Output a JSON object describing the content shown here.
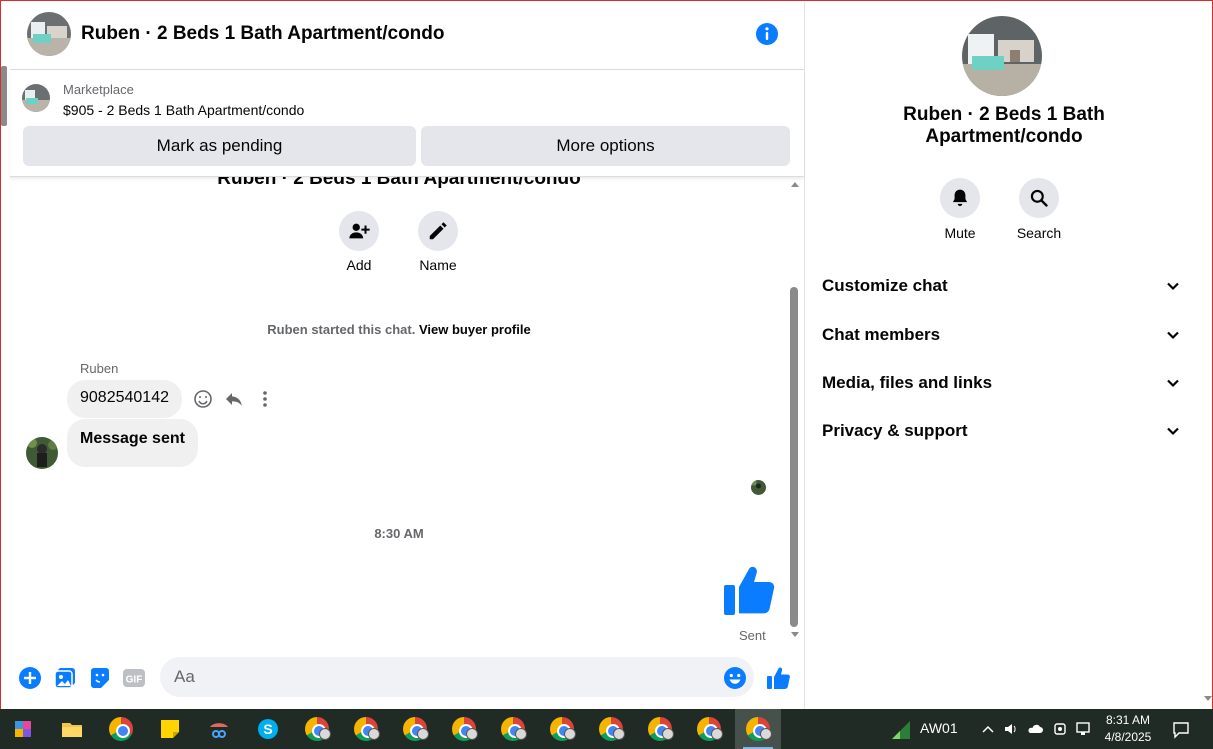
{
  "chat": {
    "title": "Ruben · 2 Beds 1 Bath Apartment/condo",
    "marketplace_label": "Marketplace",
    "listing": "$905 - 2 Beds 1 Bath Apartment/condo",
    "mark_pending": "Mark as pending",
    "more_options": "More options",
    "thread_title": "Ruben · 2 Beds 1 Bath Apartment/condo",
    "add_label": "Add",
    "name_label": "Name",
    "started_text": "Ruben started this chat. ",
    "buyer_profile_link": "View buyer profile",
    "sender": "Ruben",
    "message1": "9082540142",
    "message2": "Message sent",
    "timestamp": "8:30 AM",
    "sent_status": "Sent",
    "input_placeholder": "Aa"
  },
  "info": {
    "title": "Ruben · 2 Beds 1 Bath Apartment/condo",
    "mute_label": "Mute",
    "search_label": "Search",
    "sections": [
      "Customize chat",
      "Chat members",
      "Media, files and links",
      "Privacy & support"
    ]
  },
  "taskbar": {
    "network_label": "AW01",
    "time": "8:31 AM",
    "date": "4/8/2025"
  },
  "colors": {
    "accent": "#0a7cff",
    "bubble": "#f0f0f0",
    "button": "#e4e6eb",
    "taskbar": "#1f2b24"
  }
}
